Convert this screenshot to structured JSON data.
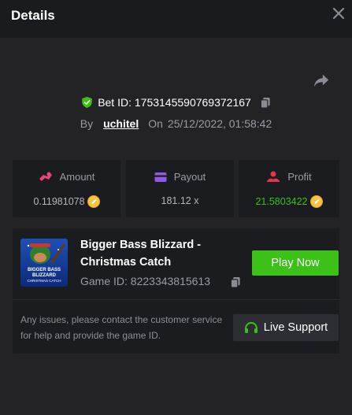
{
  "header": {
    "title": "Details"
  },
  "bet": {
    "id_text": "Bet ID: 1753145590769372167",
    "by_label": "By",
    "user": "uchitel",
    "on_label": "On",
    "date": "25/12/2022, 01:58:42"
  },
  "stats": [
    {
      "label": "Amount",
      "value": "0.11981078",
      "icon": "amount-icon",
      "value_color": "#b5b6bc",
      "coin": true
    },
    {
      "label": "Payout",
      "value": "181.12 x",
      "icon": "wallet-icon",
      "value_color": "#b5b6bc",
      "coin": false
    },
    {
      "label": "Profit",
      "value": "21.5803422",
      "icon": "profit-icon",
      "value_color": "#3bc117",
      "coin": true
    }
  ],
  "game": {
    "name": "Bigger Bass Blizzard - Christmas Catch",
    "id_text": "Game ID: 8223343815613",
    "play_label": "Play Now",
    "thumb_text": "BIGGER BASS BLIZZARD CHRISTMAS CATCH"
  },
  "support": {
    "message": "Any issues, please contact the customer service for help and provide the game ID.",
    "button_label": "Live Support"
  },
  "colors": {
    "accent_green": "#3bc117",
    "background": "#232326",
    "panel": "#1b1c1f"
  }
}
